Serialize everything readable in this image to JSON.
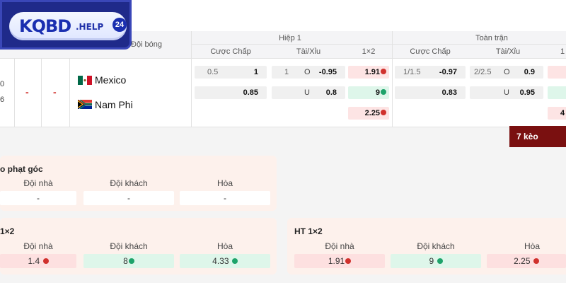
{
  "logo": {
    "main": "KQBD",
    "suffix": ".HELP",
    "badge": "24"
  },
  "header": {
    "team_col": "Đội bóng",
    "first_half": "Hiệp 1",
    "full_time": "Toàn trận",
    "handicap": "Cược Chấp",
    "over_under": "Tài/Xỉu",
    "one_x_two": "1×2",
    "full_one_x_two_partial": "1"
  },
  "match": {
    "left_top": "0",
    "left_bottom": "6",
    "home_score": "-",
    "away_score": "-",
    "home_team": "Mexico",
    "away_team": "Nam Phi"
  },
  "first_half": {
    "handicap": [
      {
        "line": "0.5",
        "odds": "1"
      },
      {
        "line": "",
        "odds": "0.85"
      }
    ],
    "ou": [
      {
        "line": "1",
        "side": "O",
        "odds": "-0.95"
      },
      {
        "line": "",
        "side": "U",
        "odds": "0.8"
      }
    ],
    "x12": [
      "1.91",
      "9",
      "2.25"
    ]
  },
  "full_time": {
    "handicap": [
      {
        "line": "1/1.5",
        "odds": "-0.97"
      },
      {
        "line": "",
        "odds": "0.83"
      }
    ],
    "ou": [
      {
        "line": "2/2.5",
        "side": "O",
        "odds": "0.9"
      },
      {
        "line": "",
        "side": "U",
        "odds": "0.95"
      }
    ],
    "x12_partial": "4"
  },
  "more_bets": "7 kèo",
  "corner_panel": {
    "title": "o phạt góc",
    "labels": [
      "Đội nhà",
      "Đội khách",
      "Hòa"
    ],
    "values": [
      "-",
      "-",
      "-"
    ]
  },
  "ft_panel": {
    "title": "1×2",
    "labels": [
      "Đội nhà",
      "Đội khách",
      "Hòa"
    ],
    "values": [
      "1.4",
      "8",
      "4.33"
    ]
  },
  "ht_panel": {
    "title": "HT 1×2",
    "labels": [
      "Đội nhà",
      "Đội khách",
      "Hòa"
    ],
    "values": [
      "1.91",
      "9",
      "2.25"
    ]
  },
  "colors": {
    "down": "#d0312d",
    "up": "#1ea36a",
    "keo_bg": "#7a1010",
    "logo_bg": "#1f2a8a"
  },
  "icons": {
    "odds_down": "red-down-arrow-icon",
    "odds_up": "green-up-arrow-icon"
  }
}
